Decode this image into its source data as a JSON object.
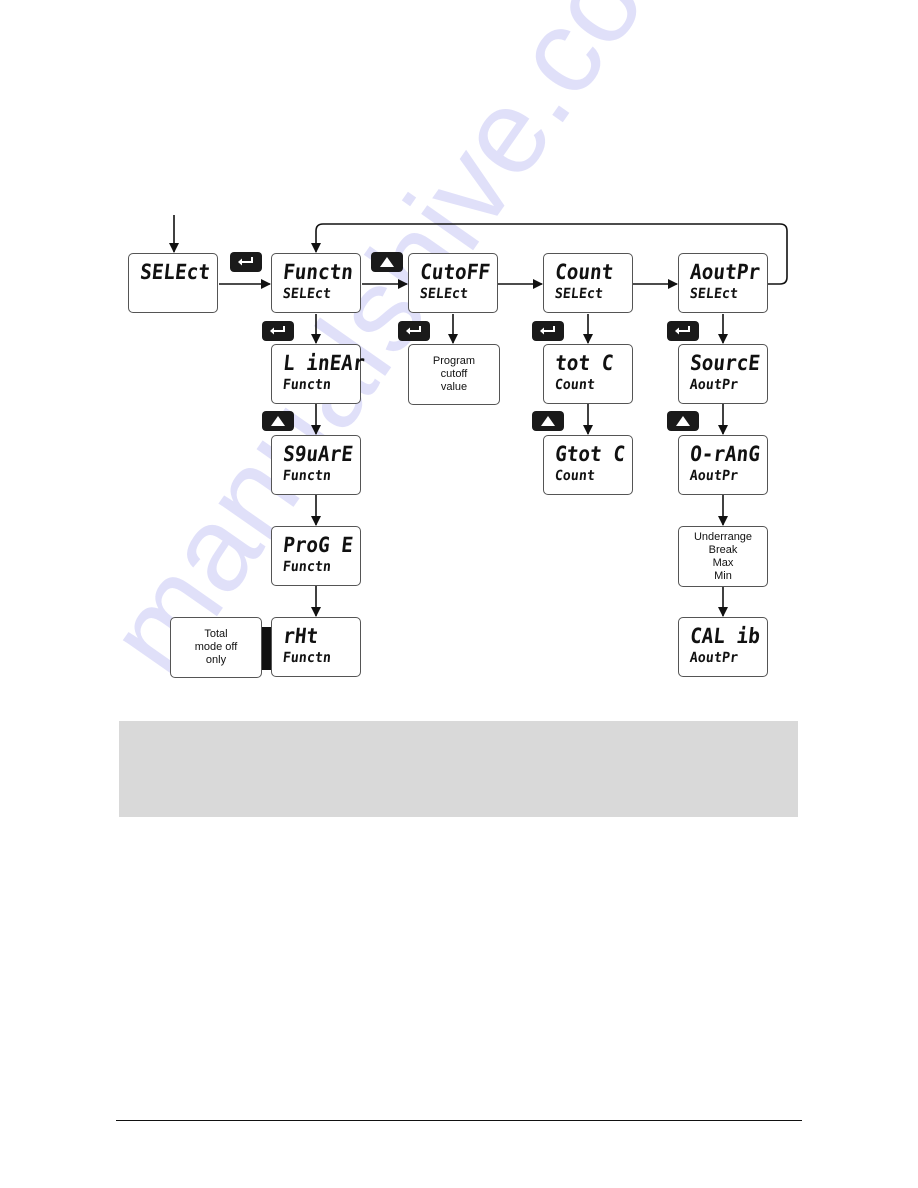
{
  "diagram": {
    "nodes": {
      "select": {
        "line1": "SELEct",
        "line2": ""
      },
      "functn": {
        "line1": "Functn",
        "line2": "SELEct"
      },
      "cutoff": {
        "line1": "CutoFF",
        "line2": "SELEct"
      },
      "count": {
        "line1": "Count",
        "line2": "SELEct"
      },
      "aoutpr": {
        "line1": "AoutPr",
        "line2": "SELEct"
      },
      "linear": {
        "line1": "L inEAr",
        "line2": "Functn"
      },
      "square": {
        "line1": "S9uArE",
        "line2": "Functn"
      },
      "proge": {
        "line1": "ProG E",
        "line2": "Functn"
      },
      "rht": {
        "line1": "rHt",
        "line2": "Functn"
      },
      "totc": {
        "line1": "tot C",
        "line2": "Count"
      },
      "gtotc": {
        "line1": "Gtot C",
        "line2": "Count"
      },
      "source": {
        "line1": "SourcE",
        "line2": "AoutPr"
      },
      "orang": {
        "line1": "O-rAnG",
        "line2": "AoutPr"
      },
      "calib": {
        "line1": "CAL ib",
        "line2": "AoutPr"
      }
    },
    "notes": {
      "program_cutoff": [
        "Program",
        "cutoff",
        "value"
      ],
      "total_mode_off": [
        "Total",
        "mode off",
        "only"
      ],
      "outrange_options": [
        "Underrange",
        "Break",
        "Max",
        "Min"
      ]
    },
    "keys": {
      "enter": {
        "icon": "enter-key-icon"
      },
      "up": {
        "icon": "up-arrow-key-icon"
      }
    }
  },
  "note_panel": {
    "text": ""
  },
  "watermark": {
    "text": "manualshive.com",
    "color": "#c8c8f5"
  }
}
